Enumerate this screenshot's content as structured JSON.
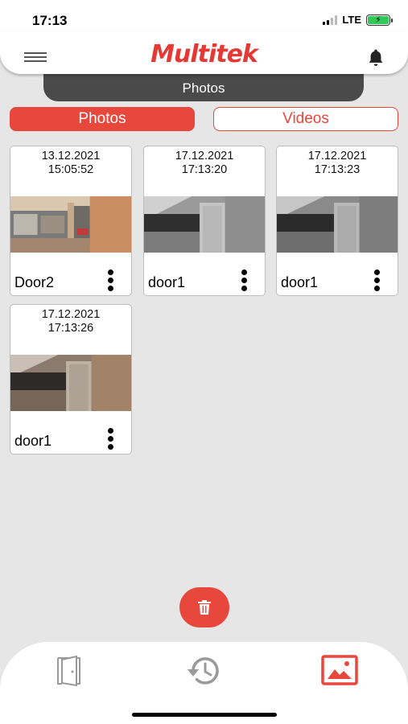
{
  "status_bar": {
    "time": "17:13",
    "network": "LTE"
  },
  "header": {
    "logo": "Multitek",
    "menu_icon": "hamburger-menu-icon",
    "bell_icon": "bell-icon"
  },
  "section": {
    "title": "Photos"
  },
  "toggle": {
    "photos_label": "Photos",
    "videos_label": "Videos",
    "active": "Photos"
  },
  "photos": [
    {
      "date": "13.12.2021",
      "time": "15:05:52",
      "name": "Door2"
    },
    {
      "date": "17.12.2021",
      "time": "17:13:20",
      "name": "door1"
    },
    {
      "date": "17.12.2021",
      "time": "17:13:23",
      "name": "door1"
    },
    {
      "date": "17.12.2021",
      "time": "17:13:26",
      "name": "door1"
    }
  ],
  "actions": {
    "delete_icon": "trash-icon"
  },
  "bottom_nav": {
    "items": [
      "door-icon",
      "history-icon",
      "gallery-icon"
    ],
    "active": "gallery-icon"
  },
  "colors": {
    "accent": "#e8473c",
    "section_bg": "#4a4a4a",
    "page_bg": "#e6e6e6",
    "inactive_icon": "#9a9a9a"
  }
}
